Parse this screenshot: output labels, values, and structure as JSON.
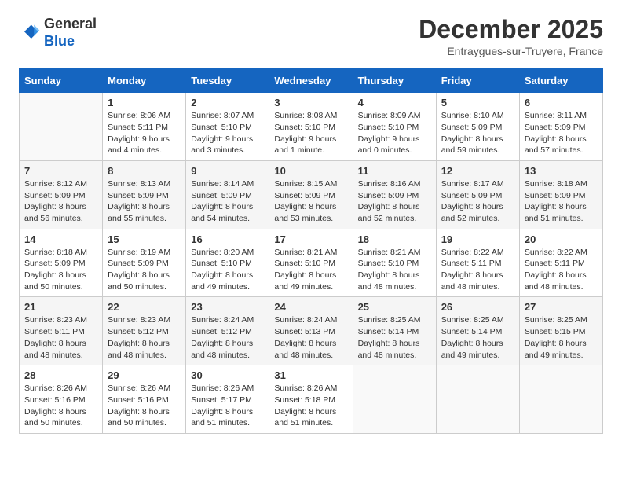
{
  "header": {
    "logo_general": "General",
    "logo_blue": "Blue",
    "month_title": "December 2025",
    "location": "Entraygues-sur-Truyere, France"
  },
  "days_of_week": [
    "Sunday",
    "Monday",
    "Tuesday",
    "Wednesday",
    "Thursday",
    "Friday",
    "Saturday"
  ],
  "weeks": [
    [
      {
        "day": "",
        "info": ""
      },
      {
        "day": "1",
        "info": "Sunrise: 8:06 AM\nSunset: 5:11 PM\nDaylight: 9 hours\nand 4 minutes."
      },
      {
        "day": "2",
        "info": "Sunrise: 8:07 AM\nSunset: 5:10 PM\nDaylight: 9 hours\nand 3 minutes."
      },
      {
        "day": "3",
        "info": "Sunrise: 8:08 AM\nSunset: 5:10 PM\nDaylight: 9 hours\nand 1 minute."
      },
      {
        "day": "4",
        "info": "Sunrise: 8:09 AM\nSunset: 5:10 PM\nDaylight: 9 hours\nand 0 minutes."
      },
      {
        "day": "5",
        "info": "Sunrise: 8:10 AM\nSunset: 5:09 PM\nDaylight: 8 hours\nand 59 minutes."
      },
      {
        "day": "6",
        "info": "Sunrise: 8:11 AM\nSunset: 5:09 PM\nDaylight: 8 hours\nand 57 minutes."
      }
    ],
    [
      {
        "day": "7",
        "info": "Sunrise: 8:12 AM\nSunset: 5:09 PM\nDaylight: 8 hours\nand 56 minutes."
      },
      {
        "day": "8",
        "info": "Sunrise: 8:13 AM\nSunset: 5:09 PM\nDaylight: 8 hours\nand 55 minutes."
      },
      {
        "day": "9",
        "info": "Sunrise: 8:14 AM\nSunset: 5:09 PM\nDaylight: 8 hours\nand 54 minutes."
      },
      {
        "day": "10",
        "info": "Sunrise: 8:15 AM\nSunset: 5:09 PM\nDaylight: 8 hours\nand 53 minutes."
      },
      {
        "day": "11",
        "info": "Sunrise: 8:16 AM\nSunset: 5:09 PM\nDaylight: 8 hours\nand 52 minutes."
      },
      {
        "day": "12",
        "info": "Sunrise: 8:17 AM\nSunset: 5:09 PM\nDaylight: 8 hours\nand 52 minutes."
      },
      {
        "day": "13",
        "info": "Sunrise: 8:18 AM\nSunset: 5:09 PM\nDaylight: 8 hours\nand 51 minutes."
      }
    ],
    [
      {
        "day": "14",
        "info": "Sunrise: 8:18 AM\nSunset: 5:09 PM\nDaylight: 8 hours\nand 50 minutes."
      },
      {
        "day": "15",
        "info": "Sunrise: 8:19 AM\nSunset: 5:09 PM\nDaylight: 8 hours\nand 50 minutes."
      },
      {
        "day": "16",
        "info": "Sunrise: 8:20 AM\nSunset: 5:10 PM\nDaylight: 8 hours\nand 49 minutes."
      },
      {
        "day": "17",
        "info": "Sunrise: 8:21 AM\nSunset: 5:10 PM\nDaylight: 8 hours\nand 49 minutes."
      },
      {
        "day": "18",
        "info": "Sunrise: 8:21 AM\nSunset: 5:10 PM\nDaylight: 8 hours\nand 48 minutes."
      },
      {
        "day": "19",
        "info": "Sunrise: 8:22 AM\nSunset: 5:11 PM\nDaylight: 8 hours\nand 48 minutes."
      },
      {
        "day": "20",
        "info": "Sunrise: 8:22 AM\nSunset: 5:11 PM\nDaylight: 8 hours\nand 48 minutes."
      }
    ],
    [
      {
        "day": "21",
        "info": "Sunrise: 8:23 AM\nSunset: 5:11 PM\nDaylight: 8 hours\nand 48 minutes."
      },
      {
        "day": "22",
        "info": "Sunrise: 8:23 AM\nSunset: 5:12 PM\nDaylight: 8 hours\nand 48 minutes."
      },
      {
        "day": "23",
        "info": "Sunrise: 8:24 AM\nSunset: 5:12 PM\nDaylight: 8 hours\nand 48 minutes."
      },
      {
        "day": "24",
        "info": "Sunrise: 8:24 AM\nSunset: 5:13 PM\nDaylight: 8 hours\nand 48 minutes."
      },
      {
        "day": "25",
        "info": "Sunrise: 8:25 AM\nSunset: 5:14 PM\nDaylight: 8 hours\nand 48 minutes."
      },
      {
        "day": "26",
        "info": "Sunrise: 8:25 AM\nSunset: 5:14 PM\nDaylight: 8 hours\nand 49 minutes."
      },
      {
        "day": "27",
        "info": "Sunrise: 8:25 AM\nSunset: 5:15 PM\nDaylight: 8 hours\nand 49 minutes."
      }
    ],
    [
      {
        "day": "28",
        "info": "Sunrise: 8:26 AM\nSunset: 5:16 PM\nDaylight: 8 hours\nand 50 minutes."
      },
      {
        "day": "29",
        "info": "Sunrise: 8:26 AM\nSunset: 5:16 PM\nDaylight: 8 hours\nand 50 minutes."
      },
      {
        "day": "30",
        "info": "Sunrise: 8:26 AM\nSunset: 5:17 PM\nDaylight: 8 hours\nand 51 minutes."
      },
      {
        "day": "31",
        "info": "Sunrise: 8:26 AM\nSunset: 5:18 PM\nDaylight: 8 hours\nand 51 minutes."
      },
      {
        "day": "",
        "info": ""
      },
      {
        "day": "",
        "info": ""
      },
      {
        "day": "",
        "info": ""
      }
    ]
  ]
}
